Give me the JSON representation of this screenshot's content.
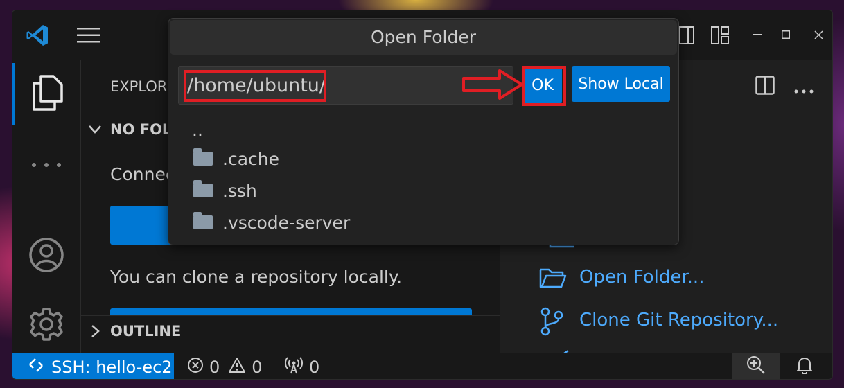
{
  "window": {
    "menu_icon": "hamburger-menu-icon",
    "app_icon": "vscode-logo-icon"
  },
  "sidebar": {
    "title": "EXPLORE",
    "no_folder_section": "NO FOL",
    "connect_text": "Connec",
    "clone_text": "You can clone a repository locally.",
    "outline_section": "OUTLINE"
  },
  "editor": {
    "links": [
      {
        "label": "Open Folder...",
        "icon": "folder-open-icon"
      },
      {
        "label": "Clone Git Repository...",
        "icon": "git-branch-icon"
      }
    ]
  },
  "dialog": {
    "title": "Open Folder",
    "input_value": "/home/ubuntu/",
    "ok_label": "OK",
    "show_local_label": "Show Local",
    "items": [
      {
        "name": "..",
        "is_folder": false
      },
      {
        "name": ".cache",
        "is_folder": true
      },
      {
        "name": ".ssh",
        "is_folder": true
      },
      {
        "name": ".vscode-server",
        "is_folder": true
      }
    ]
  },
  "statusbar": {
    "remote_label": "SSH: hello-ec2",
    "errors": "0",
    "warnings": "0",
    "ports": "0"
  },
  "colors": {
    "accent": "#0078d4",
    "link": "#4daafc",
    "annotation": "#e01e24"
  }
}
